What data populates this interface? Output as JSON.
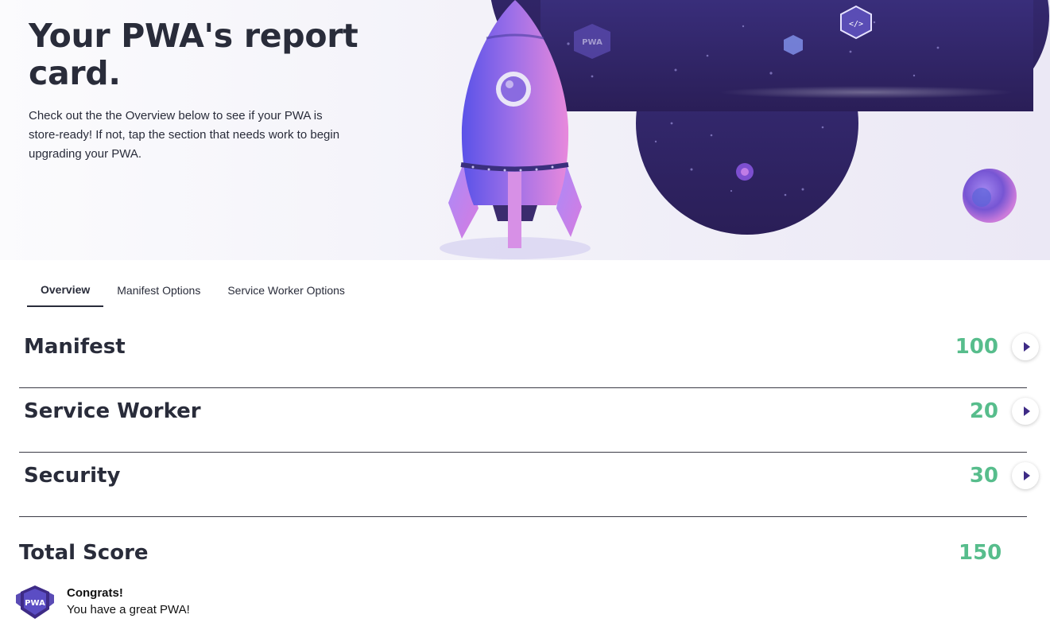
{
  "hero": {
    "title": "Your PWA's report card.",
    "description": "Check out the the Overview below to see if your PWA is store-ready! If not, tap the section that needs work to begin upgrading your PWA.",
    "badge_text": "PWA"
  },
  "tabs": [
    {
      "label": "Overview",
      "active": true
    },
    {
      "label": "Manifest Options",
      "active": false
    },
    {
      "label": "Service Worker Options",
      "active": false
    }
  ],
  "scores": [
    {
      "label": "Manifest",
      "score": "100",
      "icon": "chevron-right-icon"
    },
    {
      "label": "Service Worker",
      "score": "20",
      "icon": "chevron-right-icon"
    },
    {
      "label": "Security",
      "score": "30",
      "icon": "chevron-right-icon"
    }
  ],
  "total": {
    "label": "Total Score",
    "score": "150"
  },
  "congrats": {
    "title": "Congrats!",
    "message": "You have a great PWA!",
    "badge_text": "PWA"
  },
  "colors": {
    "score_green": "#57bd8c",
    "accent_purple": "#3e2b86",
    "text_dark": "#292c3a"
  }
}
